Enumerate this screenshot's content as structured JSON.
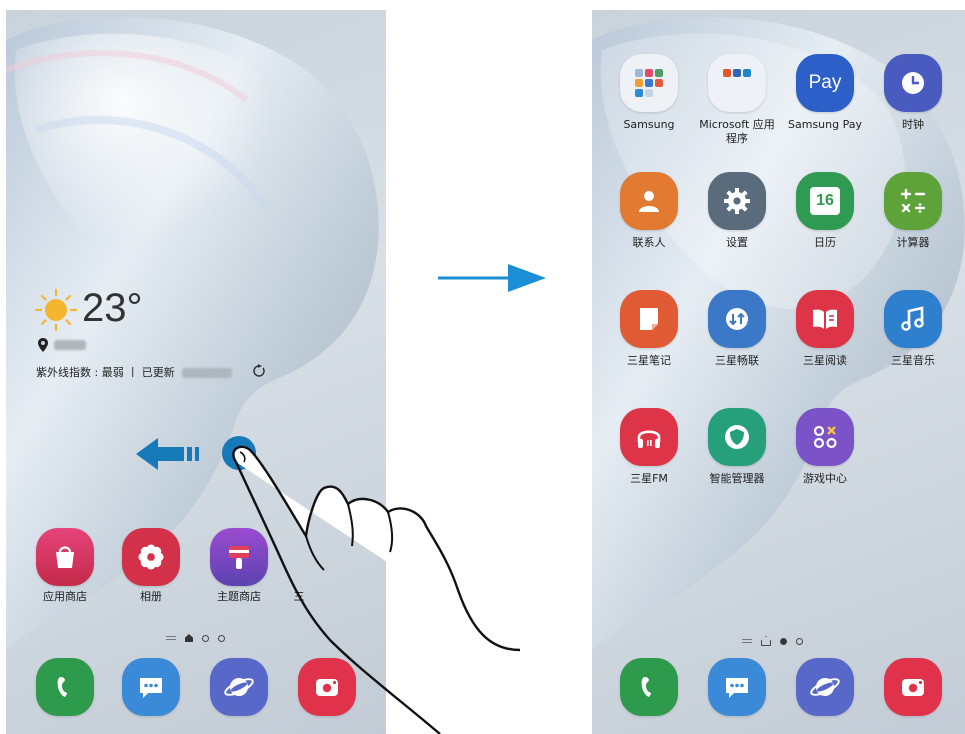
{
  "left_screen": {
    "weather": {
      "temperature": "23°",
      "uv_text": "紫外线指数 : 最弱 丨 已更新"
    },
    "apps": [
      {
        "label": "应用商店",
        "icon": "galaxy-store-icon",
        "color": "#d2345a"
      },
      {
        "label": "相册",
        "icon": "gallery-icon",
        "color": "#d3304a"
      },
      {
        "label": "主题商店",
        "icon": "themes-icon",
        "color": "#7b4bb8"
      },
      {
        "label": "三",
        "icon": "partial-app-icon",
        "color": "#555555"
      }
    ],
    "dock": [
      {
        "icon": "phone-icon",
        "color": "#2e9a4b"
      },
      {
        "icon": "messages-icon",
        "color": "#3b8ad8"
      },
      {
        "icon": "internet-icon",
        "color": "#5868c8"
      },
      {
        "icon": "camera-icon",
        "color": "#e0324a"
      }
    ]
  },
  "right_screen": {
    "apps": [
      {
        "label": "Samsung",
        "icon": "samsung-folder-icon",
        "color": "#e6ebf0"
      },
      {
        "label": "Microsoft 应用\n程序",
        "icon": "microsoft-folder-icon",
        "color": "#e6ebf0"
      },
      {
        "label": "Samsung Pay",
        "icon": "samsung-pay-icon",
        "color": "#2d5fc8",
        "text": "Pay"
      },
      {
        "label": "时钟",
        "icon": "clock-icon",
        "color": "#4a5bc0"
      },
      {
        "label": "联系人",
        "icon": "contacts-icon",
        "color": "#e27a32"
      },
      {
        "label": "设置",
        "icon": "settings-icon",
        "color": "#5a6b7c"
      },
      {
        "label": "日历",
        "icon": "calendar-icon",
        "color": "#2f9a52",
        "text": "16"
      },
      {
        "label": "计算器",
        "icon": "calculator-icon",
        "color": "#5ea23a"
      },
      {
        "label": "三星笔记",
        "icon": "samsung-notes-icon",
        "color": "#e05a34"
      },
      {
        "label": "三星畅联",
        "icon": "samsung-connect-icon",
        "color": "#3c78c8"
      },
      {
        "label": "三星阅读",
        "icon": "samsung-reader-icon",
        "color": "#dd3448"
      },
      {
        "label": "三星音乐",
        "icon": "music-icon",
        "color": "#2f7fcf"
      },
      {
        "label": "三星FM",
        "icon": "fm-radio-icon",
        "color": "#dd3448"
      },
      {
        "label": "智能管理器",
        "icon": "smart-manager-icon",
        "color": "#26a07a"
      },
      {
        "label": "游戏中心",
        "icon": "game-center-icon",
        "color": "#7b52c8"
      }
    ],
    "dock": [
      {
        "icon": "phone-icon",
        "color": "#2e9a4b"
      },
      {
        "icon": "messages-icon",
        "color": "#3b8ad8"
      },
      {
        "icon": "internet-icon",
        "color": "#5868c8"
      },
      {
        "icon": "camera-icon",
        "color": "#e0324a"
      }
    ]
  },
  "gesture": {
    "arrow_color": "#1a8fd6",
    "swipe_arrow_color": "#1679b8"
  }
}
